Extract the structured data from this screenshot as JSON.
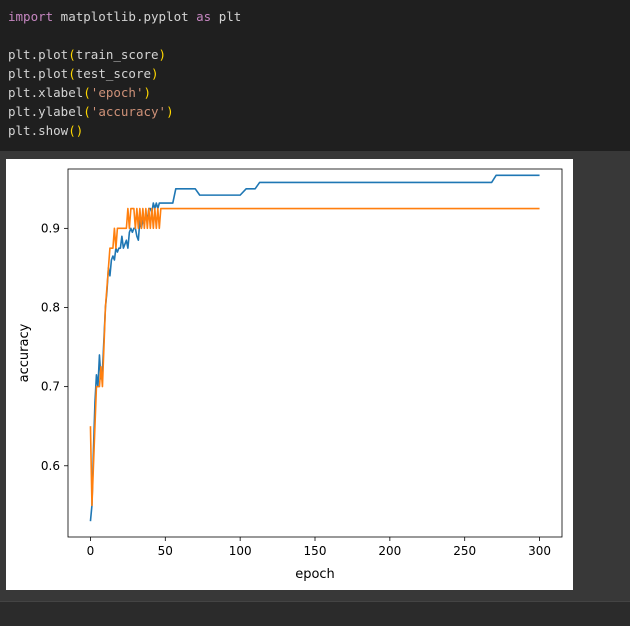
{
  "code": {
    "lines": [
      [
        {
          "t": "import",
          "c": "kw"
        },
        {
          "t": " matplotlib.pyplot "
        },
        {
          "t": "as",
          "c": "kw"
        },
        {
          "t": " plt"
        }
      ],
      [],
      [
        {
          "t": "plt.plot"
        },
        {
          "t": "(",
          "c": "paren"
        },
        {
          "t": "train_score"
        },
        {
          "t": ")",
          "c": "paren"
        }
      ],
      [
        {
          "t": "plt.plot"
        },
        {
          "t": "(",
          "c": "paren"
        },
        {
          "t": "test_score"
        },
        {
          "t": ")",
          "c": "paren"
        }
      ],
      [
        {
          "t": "plt.xlabel"
        },
        {
          "t": "(",
          "c": "paren"
        },
        {
          "t": "'epoch'",
          "c": "str"
        },
        {
          "t": ")",
          "c": "paren"
        }
      ],
      [
        {
          "t": "plt.ylabel"
        },
        {
          "t": "(",
          "c": "paren"
        },
        {
          "t": "'accuracy'",
          "c": "str"
        },
        {
          "t": ")",
          "c": "paren"
        }
      ],
      [
        {
          "t": "plt.show"
        },
        {
          "t": "()",
          "c": "paren"
        }
      ]
    ]
  },
  "chart_data": {
    "type": "line",
    "xlabel": "epoch",
    "ylabel": "accuracy",
    "xlim": [
      -15,
      315
    ],
    "ylim": [
      0.51,
      0.975
    ],
    "xticks": [
      0,
      50,
      100,
      150,
      200,
      250,
      300
    ],
    "yticks": [
      0.6,
      0.7,
      0.8,
      0.9
    ],
    "ytick_labels": [
      "0.6",
      "0.7",
      "0.8",
      "0.9"
    ],
    "grid": false,
    "series": [
      {
        "color": "#1f77b4",
        "points": [
          [
            0,
            0.53
          ],
          [
            1,
            0.55
          ],
          [
            2,
            0.62
          ],
          [
            3,
            0.68
          ],
          [
            4,
            0.715
          ],
          [
            5,
            0.7
          ],
          [
            6,
            0.74
          ],
          [
            7,
            0.71
          ],
          [
            8,
            0.72
          ],
          [
            9,
            0.76
          ],
          [
            10,
            0.8
          ],
          [
            11,
            0.82
          ],
          [
            12,
            0.85
          ],
          [
            13,
            0.84
          ],
          [
            14,
            0.86
          ],
          [
            15,
            0.865
          ],
          [
            16,
            0.86
          ],
          [
            17,
            0.875
          ],
          [
            18,
            0.87
          ],
          [
            19,
            0.875
          ],
          [
            20,
            0.875
          ],
          [
            21,
            0.89
          ],
          [
            22,
            0.875
          ],
          [
            23,
            0.88
          ],
          [
            24,
            0.885
          ],
          [
            25,
            0.875
          ],
          [
            26,
            0.895
          ],
          [
            27,
            0.9
          ],
          [
            28,
            0.895
          ],
          [
            29,
            0.9
          ],
          [
            30,
            0.9
          ],
          [
            31,
            0.89
          ],
          [
            32,
            0.885
          ],
          [
            33,
            0.91
          ],
          [
            34,
            0.9
          ],
          [
            35,
            0.91
          ],
          [
            36,
            0.905
          ],
          [
            37,
            0.92
          ],
          [
            38,
            0.91
          ],
          [
            39,
            0.925
          ],
          [
            40,
            0.925
          ],
          [
            41,
            0.92
          ],
          [
            42,
            0.932
          ],
          [
            43,
            0.925
          ],
          [
            44,
            0.932
          ],
          [
            45,
            0.925
          ],
          [
            46,
            0.932
          ],
          [
            47,
            0.932
          ],
          [
            55,
            0.932
          ],
          [
            57,
            0.95
          ],
          [
            70,
            0.95
          ],
          [
            73,
            0.942
          ],
          [
            100,
            0.942
          ],
          [
            104,
            0.95
          ],
          [
            110,
            0.95
          ],
          [
            113,
            0.958
          ],
          [
            268,
            0.958
          ],
          [
            271,
            0.967
          ],
          [
            300,
            0.967
          ]
        ]
      },
      {
        "color": "#ff7f0e",
        "points": [
          [
            0,
            0.65
          ],
          [
            1,
            0.55
          ],
          [
            2,
            0.6
          ],
          [
            3,
            0.65
          ],
          [
            4,
            0.7
          ],
          [
            5,
            0.7
          ],
          [
            6,
            0.7
          ],
          [
            7,
            0.725
          ],
          [
            8,
            0.7
          ],
          [
            9,
            0.75
          ],
          [
            10,
            0.8
          ],
          [
            11,
            0.825
          ],
          [
            12,
            0.85
          ],
          [
            13,
            0.875
          ],
          [
            14,
            0.875
          ],
          [
            15,
            0.875
          ],
          [
            16,
            0.9
          ],
          [
            17,
            0.875
          ],
          [
            18,
            0.9
          ],
          [
            19,
            0.9
          ],
          [
            20,
            0.9
          ],
          [
            21,
            0.9
          ],
          [
            22,
            0.9
          ],
          [
            23,
            0.9
          ],
          [
            24,
            0.9
          ],
          [
            25,
            0.925
          ],
          [
            26,
            0.9
          ],
          [
            27,
            0.925
          ],
          [
            28,
            0.925
          ],
          [
            29,
            0.925
          ],
          [
            30,
            0.9
          ],
          [
            31,
            0.925
          ],
          [
            32,
            0.9
          ],
          [
            33,
            0.925
          ],
          [
            34,
            0.9
          ],
          [
            35,
            0.925
          ],
          [
            36,
            0.9
          ],
          [
            37,
            0.925
          ],
          [
            38,
            0.9
          ],
          [
            39,
            0.925
          ],
          [
            40,
            0.9
          ],
          [
            41,
            0.925
          ],
          [
            42,
            0.9
          ],
          [
            43,
            0.925
          ],
          [
            44,
            0.9
          ],
          [
            45,
            0.925
          ],
          [
            46,
            0.9
          ],
          [
            47,
            0.925
          ],
          [
            48,
            0.925
          ],
          [
            300,
            0.925
          ]
        ]
      }
    ]
  }
}
